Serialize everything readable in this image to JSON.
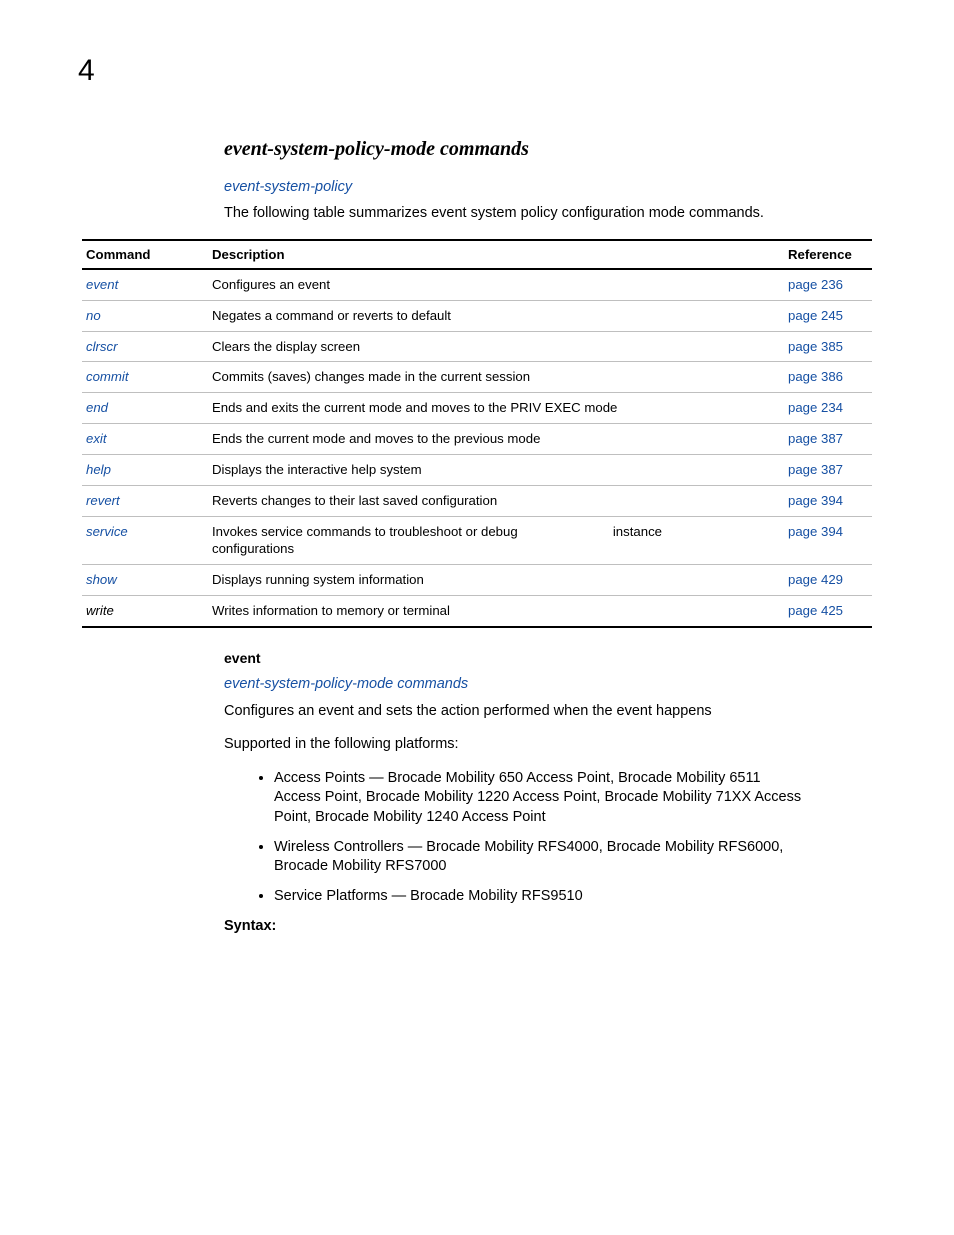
{
  "chapter_number": "4",
  "section_title": "event-system-policy-mode commands",
  "section_xref": "event-system-policy",
  "intro_text": "The following table summarizes event system policy configuration mode commands.",
  "table": {
    "headers": {
      "command": "Command",
      "description": "Description",
      "reference": "Reference"
    },
    "rows": [
      {
        "cmd": "event",
        "cmd_style": "link",
        "desc": "Configures an event",
        "extra": "",
        "ref": "page 236"
      },
      {
        "cmd": "no",
        "cmd_style": "link",
        "desc": "Negates a command or reverts to default",
        "extra": "",
        "ref": "page 245"
      },
      {
        "cmd": "clrscr",
        "cmd_style": "link",
        "desc": "Clears the display screen",
        "extra": "",
        "ref": "page 385"
      },
      {
        "cmd": "commit",
        "cmd_style": "link",
        "desc": "Commits (saves) changes made in the current session",
        "extra": "",
        "ref": "page 386"
      },
      {
        "cmd": "end",
        "cmd_style": "link",
        "desc": "Ends and exits the current mode and moves to the PRIV EXEC mode",
        "extra": "",
        "ref": "page 234"
      },
      {
        "cmd": "exit",
        "cmd_style": "link",
        "desc": "Ends the current mode and moves to the previous mode",
        "extra": "",
        "ref": "page 387"
      },
      {
        "cmd": "help",
        "cmd_style": "link",
        "desc": "Displays the interactive help system",
        "extra": "",
        "ref": "page 387"
      },
      {
        "cmd": "revert",
        "cmd_style": "link",
        "desc": "Reverts changes to their last saved configuration",
        "extra": "",
        "ref": "page 394"
      },
      {
        "cmd": "service",
        "cmd_style": "link",
        "desc": "Invokes service commands to troubleshoot or debug configurations",
        "extra": "instance",
        "ref": "page 394"
      },
      {
        "cmd": "show",
        "cmd_style": "link",
        "desc": "Displays running system information",
        "extra": "",
        "ref": "page 429"
      },
      {
        "cmd": "write",
        "cmd_style": "plain",
        "desc": "Writes information to memory or terminal",
        "extra": "",
        "ref": "page 425"
      }
    ]
  },
  "cmd_section": {
    "heading": "event",
    "xref": "event-system-policy-mode commands",
    "desc": "Configures an event and sets the action performed when the event happens",
    "platforms_intro": "Supported in the following platforms:",
    "platforms": [
      "Access Points — Brocade Mobility 650 Access Point, Brocade Mobility 6511 Access Point, Brocade Mobility 1220 Access Point, Brocade Mobility 71XX Access Point, Brocade Mobility 1240 Access Point",
      "Wireless Controllers — Brocade Mobility RFS4000, Brocade Mobility RFS6000, Brocade Mobility RFS7000",
      "Service Platforms — Brocade Mobility RFS9510"
    ],
    "syntax_label": "Syntax:"
  }
}
